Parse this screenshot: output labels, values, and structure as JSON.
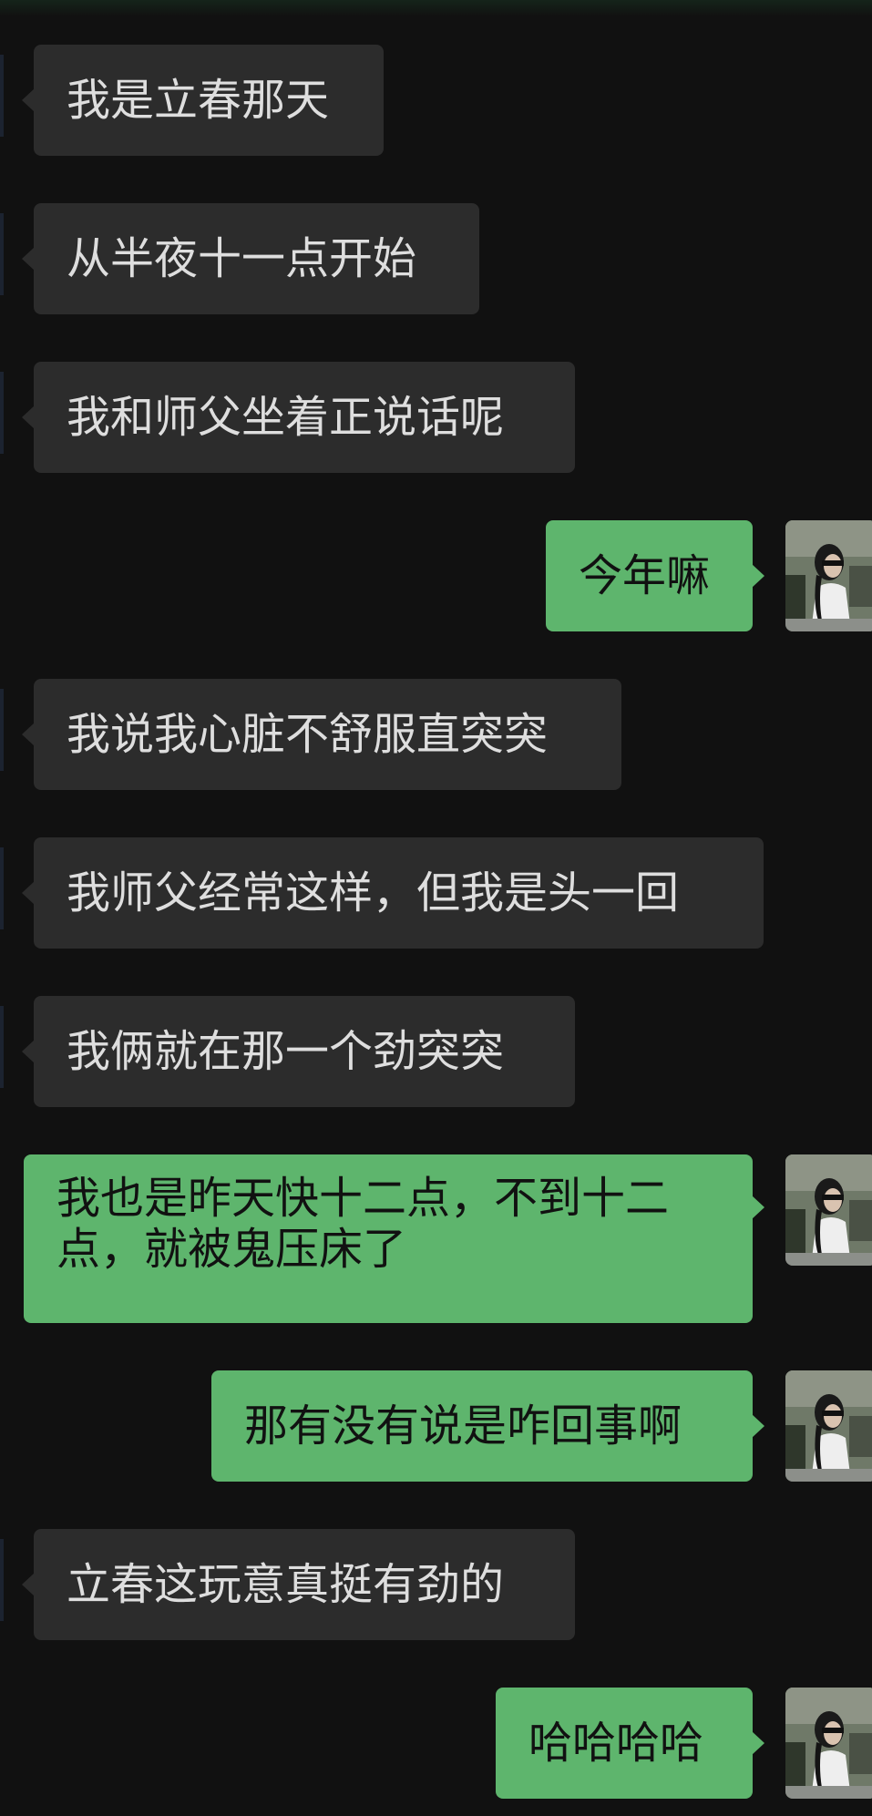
{
  "messages": [
    {
      "direction": "incoming",
      "text": "我是立春那天"
    },
    {
      "direction": "incoming",
      "text": "从半夜十一点开始"
    },
    {
      "direction": "incoming",
      "text": "我和师父坐着正说话呢"
    },
    {
      "direction": "outgoing",
      "text": "今年嘛"
    },
    {
      "direction": "incoming",
      "text": "我说我心脏不舒服直突突"
    },
    {
      "direction": "incoming",
      "text": "我师父经常这样，但我是头一回"
    },
    {
      "direction": "incoming",
      "text": "我俩就在那一个劲突突"
    },
    {
      "direction": "outgoing",
      "text": "我也是昨天快十二点，不到十二点，就被鬼压床了"
    },
    {
      "direction": "outgoing",
      "text": "那有没有说是咋回事啊"
    },
    {
      "direction": "incoming",
      "text": "立春这玩意真挺有劲的"
    },
    {
      "direction": "outgoing",
      "text": "哈哈哈哈"
    }
  ],
  "colors": {
    "background": "#111111",
    "incoming_bubble": "#2c2c2c",
    "incoming_text": "#dedede",
    "outgoing_bubble": "#5eb56d",
    "outgoing_text": "#111111"
  },
  "icons": {
    "avatar": "user-avatar-photo"
  }
}
